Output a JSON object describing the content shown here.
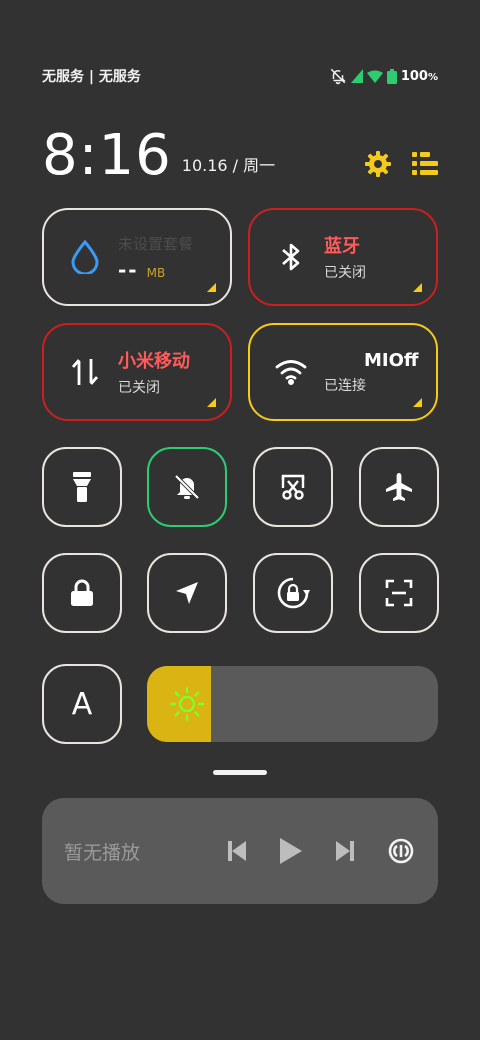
{
  "status_bar": {
    "carrier": "无服务 | 无服务",
    "battery": "100",
    "battery_unit": "%"
  },
  "header": {
    "time": "8:16",
    "date": "10.16 / 周一",
    "icons": [
      "settings-icon",
      "edit-list-icon"
    ]
  },
  "tiles": {
    "data": {
      "title": "未设置套餐",
      "value": "--",
      "unit": "MB",
      "icon": "water-drop-icon",
      "border": "#e8e6dc"
    },
    "bluetooth": {
      "title": "蓝牙",
      "sub": "已关闭",
      "icon": "bluetooth-icon",
      "border": "#cc1f1f",
      "title_color": "#ff5b5b"
    },
    "mobile": {
      "title": "小米移动",
      "sub": "已关闭",
      "icon": "mobile-data-icon",
      "border": "#cc1f1f",
      "title_color": "#ff5b5b"
    },
    "wifi": {
      "title": "MIOff",
      "sub": "已连接",
      "icon": "wifi-icon",
      "border": "#f4cb1a"
    }
  },
  "toggles": [
    {
      "name": "flashlight-button",
      "icon": "flashlight-icon",
      "border": "#e8e6dc"
    },
    {
      "name": "mute-button",
      "icon": "bell-off-icon",
      "border": "#2ecc71"
    },
    {
      "name": "screenshot-button",
      "icon": "scissors-icon",
      "border": "#e8e6dc"
    },
    {
      "name": "airplane-button",
      "icon": "airplane-icon",
      "border": "#e8e6dc"
    },
    {
      "name": "lock-button",
      "icon": "lock-icon",
      "border": "#e8e6dc"
    },
    {
      "name": "location-button",
      "icon": "location-arrow-icon",
      "border": "#e8e6dc"
    },
    {
      "name": "rotation-lock-button",
      "icon": "rotation-lock-icon",
      "border": "#e8e6dc"
    },
    {
      "name": "scan-button",
      "icon": "scan-icon",
      "border": "#e8e6dc"
    },
    {
      "name": "auto-brightness-button",
      "icon": "letter-a-icon",
      "label": "A",
      "border": "#e8e6dc"
    }
  ],
  "brightness": {
    "level": 0.22,
    "fill_color": "#d9b412",
    "icon": "sun-icon"
  },
  "media": {
    "label": "暂无播放",
    "icons": [
      "previous-icon",
      "play-icon",
      "next-icon",
      "audio-output-icon"
    ]
  },
  "colors": {
    "background": "#323232",
    "accent_yellow": "#f4cb1a",
    "off_red": "#cc1f1f",
    "on_green": "#2ecc71",
    "signal_green": "#2ecc71"
  }
}
